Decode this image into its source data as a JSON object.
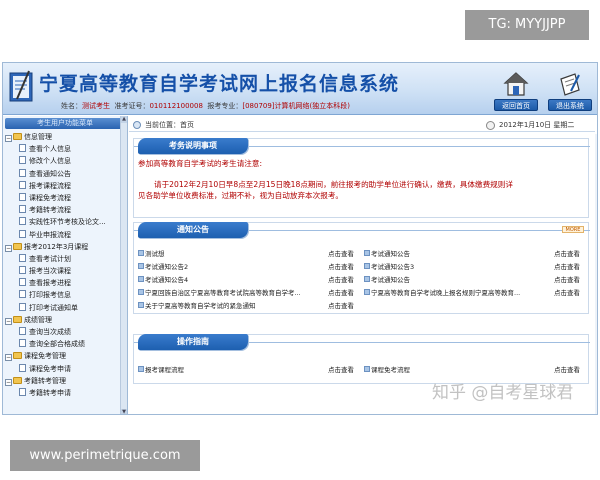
{
  "watermarks": {
    "top_right": "TG: MYYJJPP",
    "bottom_left": "www.perimetrique.com",
    "bottom_right": "知乎 @自考星球君"
  },
  "header": {
    "title": "宁夏高等教育自学考试网上报名信息系统",
    "name_label": "姓名：",
    "name_value": "测试考生",
    "ticket_label": "准考证号：",
    "ticket_value": "010112100008",
    "major_label": "报考专业：",
    "major_value": "[080709]计算机网络(独立本科段)",
    "home_button": "返回首页",
    "logout_button": "退出系统",
    "home_icon": "house-icon",
    "logout_icon": "document-pen-icon"
  },
  "sidebar": {
    "heading": "考生用户功能菜单",
    "groups": [
      {
        "label": "信息管理",
        "items": [
          "查看个人信息",
          "修改个人信息",
          "查看通知公告",
          "报考课程流程",
          "课程免考流程",
          "考籍转考流程",
          "实践性环节考核及论文...",
          "毕业申报流程"
        ]
      },
      {
        "label": "报考2012年3月课程",
        "items": [
          "查看考试计划",
          "报考当次课程",
          "查看报考进程",
          "打印报考信息",
          "打印考试通知单"
        ]
      },
      {
        "label": "成绩管理",
        "items": [
          "查询当次成绩",
          "查询全部合格成绩"
        ]
      },
      {
        "label": "课程免考管理",
        "items": [
          "课程免考申请"
        ]
      },
      {
        "label": "考籍转考管理",
        "items": [
          "考籍转考申请"
        ]
      }
    ]
  },
  "breadcrumb": {
    "label": "当前位置：首页",
    "date": "2012年1月10日 星期二"
  },
  "notice_panel": {
    "tab": "考务说明事项",
    "line1": "参加高等教育自学考试的考生请注意:",
    "line2": "请于2012年2月10日早8点至2月15日晚18点期间，前往报考的助学单位进行确认，缴费，具体缴费规则详",
    "line3": "见各助学单位收费标准，过期不补，视为自动放弃本次报考。"
  },
  "news_panel": {
    "tab": "通知公告",
    "more": "MORE",
    "view_label": "点击查看",
    "rows": [
      [
        "测试想",
        "考试通知公告"
      ],
      [
        "考试通知公告2",
        "考试通知公告3"
      ],
      [
        "考试通知公告4",
        "考试通知公告"
      ],
      [
        "宁夏回族自治区宁夏高等教育考试院高等教育自学考...",
        "宁夏高等教育自学考试晚上报名规则宁夏高等教育..."
      ],
      [
        "关于宁夏高等教育自学考试的紧急通知",
        ""
      ]
    ]
  },
  "guide_panel": {
    "tab": "操作指南",
    "view_label": "点击查看",
    "items": [
      "报考课程流程",
      "课程免考流程"
    ]
  },
  "colors": {
    "brand_blue": "#1550a8",
    "notice_red": "#b00000",
    "tab_blue": "#1d5fb0"
  }
}
